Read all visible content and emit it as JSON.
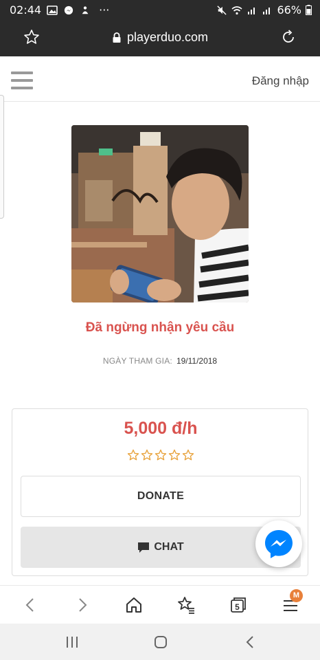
{
  "status_bar": {
    "time": "02:44",
    "battery": "66%"
  },
  "browser": {
    "url": "playerduo.com"
  },
  "header": {
    "login_label": "Đăng nhập"
  },
  "profile": {
    "status": "Đã ngừng nhận yêu cầu",
    "join_label": "NGÀY THAM GIA:",
    "join_date": "19/11/2018"
  },
  "card": {
    "price": "5,000 đ/h",
    "rating_stars": 5,
    "rating_filled": 0,
    "donate_label": "DONATE",
    "chat_label": "CHAT"
  },
  "bottom_bar": {
    "tabs_count": "5",
    "menu_badge": "M"
  },
  "colors": {
    "accent_red": "#d9534f",
    "star_color": "#e8a33d",
    "messenger_blue": "#0084ff",
    "badge_orange": "#e8803a"
  }
}
